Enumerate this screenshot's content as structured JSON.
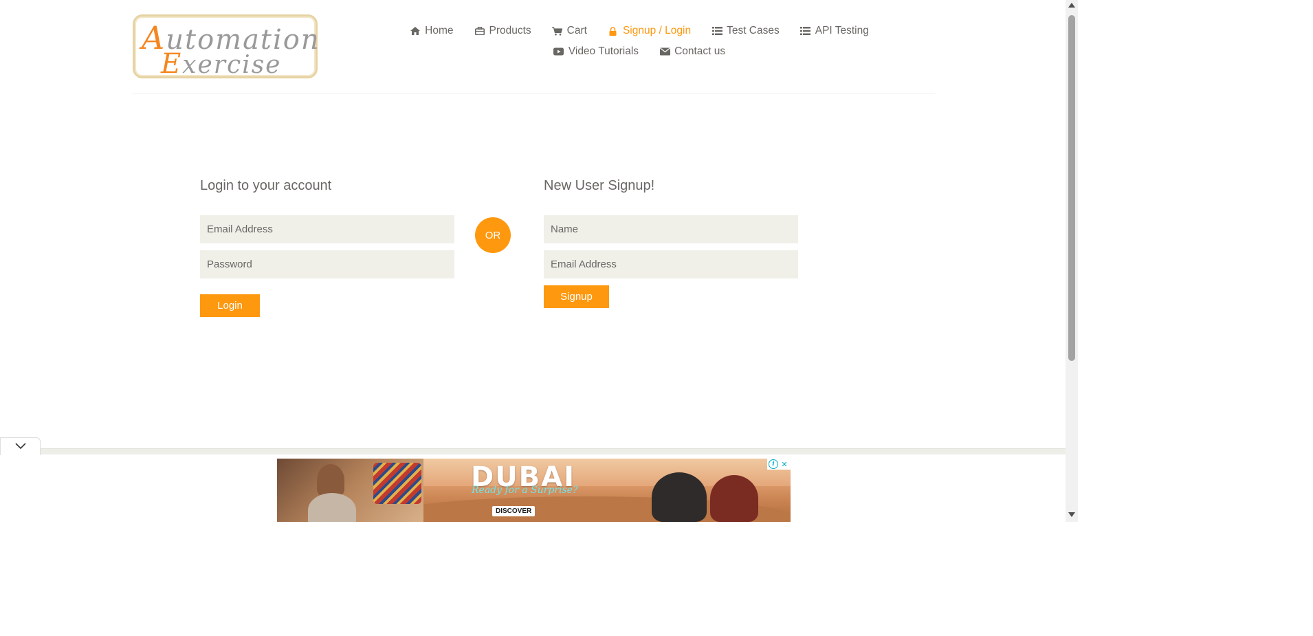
{
  "logo": {
    "line1_cap": "A",
    "line1_rest": "utomation",
    "line2_cap": "E",
    "line2_rest": "xercise"
  },
  "nav": {
    "row1": [
      {
        "label": "Home",
        "icon": "home-icon"
      },
      {
        "label": "Products",
        "icon": "briefcase-icon"
      },
      {
        "label": "Cart",
        "icon": "cart-icon"
      },
      {
        "label": "Signup / Login",
        "icon": "lock-icon",
        "active": true
      },
      {
        "label": "Test Cases",
        "icon": "list-icon"
      },
      {
        "label": "API Testing",
        "icon": "list-icon"
      }
    ],
    "row2": [
      {
        "label": "Video Tutorials",
        "icon": "youtube-play-icon"
      },
      {
        "label": "Contact us",
        "icon": "envelope-icon"
      }
    ]
  },
  "login": {
    "title": "Login to your account",
    "email_placeholder": "Email Address",
    "password_placeholder": "Password",
    "button": "Login"
  },
  "or_label": "OR",
  "signup": {
    "title": "New User Signup!",
    "name_placeholder": "Name",
    "email_placeholder": "Email Address",
    "button": "Signup"
  },
  "ad": {
    "brand": "DUBAI",
    "tagline": "Ready for a Surprise?",
    "cta": "DISCOVER",
    "info_icon": "info-icon",
    "close_icon": "close-icon"
  },
  "colors": {
    "accent": "#fe980f",
    "text": "#696763",
    "field_bg": "#f0f0e9"
  }
}
